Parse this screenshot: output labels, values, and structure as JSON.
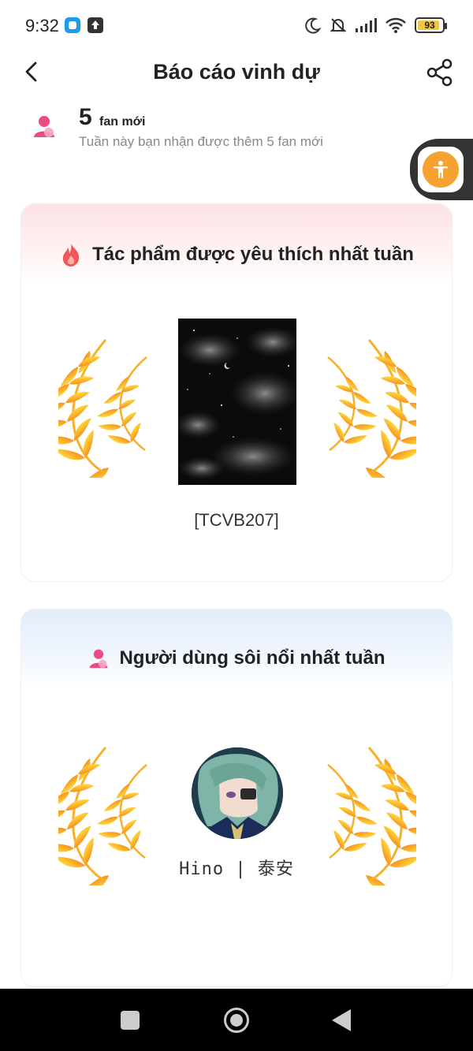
{
  "status_bar": {
    "time": "9:32",
    "battery": "93"
  },
  "header": {
    "title": "Báo cáo vinh dự",
    "back_icon": "chevron-left-icon",
    "share_icon": "share-icon"
  },
  "fans": {
    "count": "5",
    "label": "fan mới",
    "subtitle": "Tuần này bạn nhận được thêm 5 fan mới"
  },
  "favorite_work": {
    "heading": "Tác phẩm được yêu thích nhất tuần",
    "title": "[TCVB207]"
  },
  "active_user": {
    "heading": "Người dùng sôi nổi nhất tuần",
    "username": "Hino | 泰安"
  },
  "colors": {
    "laurel_light": "#ffd23a",
    "laurel_dark": "#f7931e",
    "fan_icon": "#ec4b86",
    "float_button": "#f6a233"
  }
}
